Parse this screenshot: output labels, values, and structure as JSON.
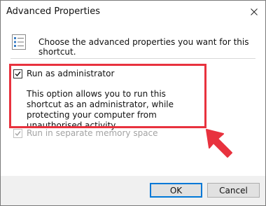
{
  "window": {
    "title": "Advanced Properties",
    "close_icon": "close-icon"
  },
  "header": {
    "icon": "properties-list-icon",
    "text": "Choose the advanced properties you want for this shortcut."
  },
  "options": {
    "run_as_admin": {
      "label": "Run as administrator",
      "checked": true,
      "enabled": true,
      "description": "This option allows you to run this shortcut as an administrator, while protecting your computer from unauthorised activity."
    },
    "separate_memory": {
      "label": "Run in separate memory space",
      "checked": true,
      "enabled": false
    }
  },
  "annotation": {
    "highlight_color": "#e8323e",
    "arrow_icon": "pointer-arrow-icon"
  },
  "buttons": {
    "ok": "OK",
    "cancel": "Cancel"
  }
}
